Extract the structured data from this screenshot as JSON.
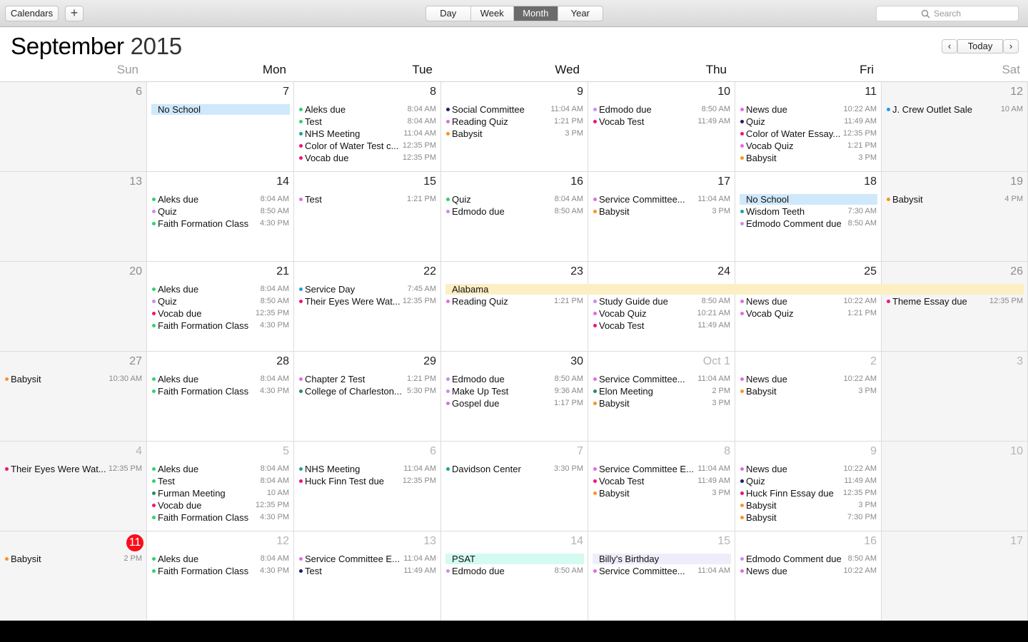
{
  "toolbar": {
    "calendars_label": "Calendars",
    "add_label": "+",
    "views": [
      "Day",
      "Week",
      "Month",
      "Year"
    ],
    "active_view": "Month",
    "search_placeholder": "Search"
  },
  "header": {
    "month": "September",
    "year": "2015",
    "today_label": "Today",
    "prev_label": "‹",
    "next_label": "›"
  },
  "weekdays": [
    "Sun",
    "Mon",
    "Tue",
    "Wed",
    "Thu",
    "Fri",
    "Sat"
  ],
  "colors": {
    "green": "#2bd46b",
    "purple": "#c98bf0",
    "teal": "#1ba39b",
    "pink": "#f0127a",
    "orange": "#f8951d",
    "blue": "#1e9af4",
    "navy": "#1c1c6e",
    "darkgreen": "#2b8a5a",
    "magenta": "#e66be0",
    "today_red": "#fb0d1b",
    "bar_blue": "#cfe8fb",
    "bar_yellow": "#fcefc4",
    "bar_mint": "#d4fbf1",
    "bar_lavender": "#eeeefb"
  },
  "weeks": [
    {
      "days": [
        {
          "num": "6",
          "dim": false,
          "events": []
        },
        {
          "num": "7",
          "dim": false,
          "events": []
        },
        {
          "num": "8",
          "dim": false,
          "events": [
            {
              "name": "Aleks due",
              "time": "8:04 AM",
              "color": "green"
            },
            {
              "name": "Test",
              "time": "8:04 AM",
              "color": "green"
            },
            {
              "name": "NHS Meeting",
              "time": "11:04 AM",
              "color": "teal"
            },
            {
              "name": "Color of Water Test c...",
              "time": "12:35 PM",
              "color": "pink"
            },
            {
              "name": "Vocab due",
              "time": "12:35 PM",
              "color": "pink"
            }
          ]
        },
        {
          "num": "9",
          "dim": false,
          "events": [
            {
              "name": "Social Committee",
              "time": "11:04 AM",
              "color": "navy"
            },
            {
              "name": "Reading Quiz",
              "time": "1:21 PM",
              "color": "magenta"
            },
            {
              "name": "Babysit",
              "time": "3 PM",
              "color": "orange"
            }
          ]
        },
        {
          "num": "10",
          "dim": false,
          "events": [
            {
              "name": "Edmodo due",
              "time": "8:50 AM",
              "color": "purple"
            },
            {
              "name": "Vocab Test",
              "time": "11:49 AM",
              "color": "pink"
            }
          ]
        },
        {
          "num": "11",
          "dim": false,
          "events": [
            {
              "name": "News due",
              "time": "10:22 AM",
              "color": "magenta"
            },
            {
              "name": "Quiz",
              "time": "11:49 AM",
              "color": "navy"
            },
            {
              "name": "Color of Water Essay...",
              "time": "12:35 PM",
              "color": "pink"
            },
            {
              "name": "Vocab Quiz",
              "time": "1:21 PM",
              "color": "magenta"
            },
            {
              "name": "Babysit",
              "time": "3 PM",
              "color": "orange"
            }
          ]
        },
        {
          "num": "12",
          "dim": false,
          "events": [
            {
              "name": "J. Crew Outlet Sale",
              "time": "10 AM",
              "color": "blue"
            }
          ]
        }
      ],
      "bars": [
        {
          "label": "No School",
          "start": 1,
          "span": 1,
          "color": "bar_blue",
          "row": 0
        }
      ]
    },
    {
      "days": [
        {
          "num": "13",
          "dim": false,
          "events": []
        },
        {
          "num": "14",
          "dim": false,
          "events": [
            {
              "name": "Aleks due",
              "time": "8:04 AM",
              "color": "green"
            },
            {
              "name": "Quiz",
              "time": "8:50 AM",
              "color": "purple"
            },
            {
              "name": "Faith Formation Class",
              "time": "4:30 PM",
              "color": "green"
            }
          ]
        },
        {
          "num": "15",
          "dim": false,
          "events": [
            {
              "name": "Test",
              "time": "1:21 PM",
              "color": "magenta"
            }
          ]
        },
        {
          "num": "16",
          "dim": false,
          "events": [
            {
              "name": "Quiz",
              "time": "8:04 AM",
              "color": "green"
            },
            {
              "name": "Edmodo due",
              "time": "8:50 AM",
              "color": "purple"
            }
          ]
        },
        {
          "num": "17",
          "dim": false,
          "events": [
            {
              "name": "Service Committee...",
              "time": "11:04 AM",
              "color": "magenta"
            },
            {
              "name": "Babysit",
              "time": "3 PM",
              "color": "orange"
            }
          ]
        },
        {
          "num": "18",
          "dim": false,
          "offset": 1,
          "events": [
            {
              "name": "Wisdom Teeth",
              "time": "7:30 AM",
              "color": "teal"
            },
            {
              "name": "Edmodo Comment due",
              "time": "8:50 AM",
              "color": "purple"
            }
          ]
        },
        {
          "num": "19",
          "dim": false,
          "events": [
            {
              "name": "Babysit",
              "time": "4 PM",
              "color": "orange"
            }
          ]
        }
      ],
      "bars": [
        {
          "label": "No School",
          "start": 5,
          "span": 1,
          "color": "bar_blue",
          "row": 0
        }
      ]
    },
    {
      "days": [
        {
          "num": "20",
          "dim": false,
          "events": []
        },
        {
          "num": "21",
          "dim": false,
          "events": [
            {
              "name": "Aleks due",
              "time": "8:04 AM",
              "color": "green"
            },
            {
              "name": "Quiz",
              "time": "8:50 AM",
              "color": "purple"
            },
            {
              "name": "Vocab due",
              "time": "12:35 PM",
              "color": "pink"
            },
            {
              "name": "Faith Formation Class",
              "time": "4:30 PM",
              "color": "green"
            }
          ]
        },
        {
          "num": "22",
          "dim": false,
          "events": [
            {
              "name": "Service Day",
              "time": "7:45 AM",
              "color": "blue"
            },
            {
              "name": "Their Eyes Were Wat...",
              "time": "12:35 PM",
              "color": "pink"
            }
          ]
        },
        {
          "num": "23",
          "dim": false,
          "offset": 1,
          "events": [
            {
              "name": "Reading Quiz",
              "time": "1:21 PM",
              "color": "magenta"
            }
          ]
        },
        {
          "num": "24",
          "dim": false,
          "offset": 1,
          "events": [
            {
              "name": "Study Guide due",
              "time": "8:50 AM",
              "color": "purple"
            },
            {
              "name": "Vocab Quiz",
              "time": "10:21 AM",
              "color": "magenta"
            },
            {
              "name": "Vocab Test",
              "time": "11:49 AM",
              "color": "pink"
            }
          ]
        },
        {
          "num": "25",
          "dim": false,
          "offset": 1,
          "events": [
            {
              "name": "News due",
              "time": "10:22 AM",
              "color": "magenta"
            },
            {
              "name": "Vocab Quiz",
              "time": "1:21 PM",
              "color": "magenta"
            }
          ]
        },
        {
          "num": "26",
          "dim": false,
          "offset": 1,
          "events": [
            {
              "name": "Theme Essay due",
              "time": "12:35 PM",
              "color": "pink"
            }
          ]
        }
      ],
      "bars": [
        {
          "label": "Alabama",
          "start": 3,
          "span": 4,
          "color": "bar_yellow",
          "row": 0
        }
      ]
    },
    {
      "days": [
        {
          "num": "27",
          "dim": false,
          "events": [
            {
              "name": "Babysit",
              "time": "10:30 AM",
              "color": "orange"
            }
          ]
        },
        {
          "num": "28",
          "dim": false,
          "events": [
            {
              "name": "Aleks due",
              "time": "8:04 AM",
              "color": "green"
            },
            {
              "name": "Faith Formation Class",
              "time": "4:30 PM",
              "color": "green"
            }
          ]
        },
        {
          "num": "29",
          "dim": false,
          "events": [
            {
              "name": "Chapter 2 Test",
              "time": "1:21 PM",
              "color": "magenta"
            },
            {
              "name": "College of Charleston...",
              "time": "5:30 PM",
              "color": "darkgreen"
            }
          ]
        },
        {
          "num": "30",
          "dim": false,
          "events": [
            {
              "name": "Edmodo due",
              "time": "8:50 AM",
              "color": "purple"
            },
            {
              "name": "Make Up Test",
              "time": "9:36 AM",
              "color": "purple"
            },
            {
              "name": "Gospel due",
              "time": "1:17 PM",
              "color": "magenta"
            }
          ]
        },
        {
          "num": "Oct 1",
          "dim": true,
          "events": [
            {
              "name": "Service Committee...",
              "time": "11:04 AM",
              "color": "magenta"
            },
            {
              "name": "Elon Meeting",
              "time": "2 PM",
              "color": "darkgreen"
            },
            {
              "name": "Babysit",
              "time": "3 PM",
              "color": "orange"
            }
          ]
        },
        {
          "num": "2",
          "dim": true,
          "events": [
            {
              "name": "News due",
              "time": "10:22 AM",
              "color": "magenta"
            },
            {
              "name": "Babysit",
              "time": "3 PM",
              "color": "orange"
            }
          ]
        },
        {
          "num": "3",
          "dim": true,
          "events": []
        }
      ],
      "bars": []
    },
    {
      "days": [
        {
          "num": "4",
          "dim": true,
          "events": [
            {
              "name": "Their Eyes Were Wat...",
              "time": "12:35 PM",
              "color": "pink"
            }
          ]
        },
        {
          "num": "5",
          "dim": true,
          "events": [
            {
              "name": "Aleks due",
              "time": "8:04 AM",
              "color": "green"
            },
            {
              "name": "Test",
              "time": "8:04 AM",
              "color": "green"
            },
            {
              "name": "Furman Meeting",
              "time": "10 AM",
              "color": "darkgreen"
            },
            {
              "name": "Vocab due",
              "time": "12:35 PM",
              "color": "pink"
            },
            {
              "name": "Faith Formation Class",
              "time": "4:30 PM",
              "color": "green"
            }
          ]
        },
        {
          "num": "6",
          "dim": true,
          "events": [
            {
              "name": "NHS Meeting",
              "time": "11:04 AM",
              "color": "teal"
            },
            {
              "name": "Huck Finn Test due",
              "time": "12:35 PM",
              "color": "pink"
            }
          ]
        },
        {
          "num": "7",
          "dim": true,
          "events": [
            {
              "name": "Davidson Center",
              "time": "3:30 PM",
              "color": "teal"
            }
          ]
        },
        {
          "num": "8",
          "dim": true,
          "events": [
            {
              "name": "Service Committee E...",
              "time": "11:04 AM",
              "color": "magenta"
            },
            {
              "name": "Vocab Test",
              "time": "11:49 AM",
              "color": "pink"
            },
            {
              "name": "Babysit",
              "time": "3 PM",
              "color": "orange"
            }
          ]
        },
        {
          "num": "9",
          "dim": true,
          "events": [
            {
              "name": "News due",
              "time": "10:22 AM",
              "color": "magenta"
            },
            {
              "name": "Quiz",
              "time": "11:49 AM",
              "color": "navy"
            },
            {
              "name": "Huck Finn Essay due",
              "time": "12:35 PM",
              "color": "pink"
            },
            {
              "name": "Babysit",
              "time": "3 PM",
              "color": "orange"
            },
            {
              "name": "Babysit",
              "time": "7:30 PM",
              "color": "orange"
            }
          ]
        },
        {
          "num": "10",
          "dim": true,
          "events": []
        }
      ],
      "bars": []
    },
    {
      "days": [
        {
          "num": "11",
          "dim": false,
          "today": true,
          "events": [
            {
              "name": "Babysit",
              "time": "2 PM",
              "color": "orange"
            }
          ]
        },
        {
          "num": "12",
          "dim": true,
          "events": [
            {
              "name": "Aleks due",
              "time": "8:04 AM",
              "color": "green"
            },
            {
              "name": "Faith Formation Class",
              "time": "4:30 PM",
              "color": "green"
            }
          ]
        },
        {
          "num": "13",
          "dim": true,
          "events": [
            {
              "name": "Service Committee E...",
              "time": "11:04 AM",
              "color": "magenta"
            },
            {
              "name": "Test",
              "time": "11:49 AM",
              "color": "navy"
            }
          ]
        },
        {
          "num": "14",
          "dim": true,
          "offset": 1,
          "events": [
            {
              "name": "Edmodo due",
              "time": "8:50 AM",
              "color": "purple"
            }
          ]
        },
        {
          "num": "15",
          "dim": true,
          "offset": 1,
          "events": [
            {
              "name": "Service Committee...",
              "time": "11:04 AM",
              "color": "magenta"
            }
          ]
        },
        {
          "num": "16",
          "dim": true,
          "events": [
            {
              "name": "Edmodo Comment due",
              "time": "8:50 AM",
              "color": "purple"
            },
            {
              "name": "News due",
              "time": "10:22 AM",
              "color": "magenta"
            }
          ]
        },
        {
          "num": "17",
          "dim": true,
          "events": []
        }
      ],
      "bars": [
        {
          "label": "PSAT",
          "start": 3,
          "span": 1,
          "color": "bar_mint",
          "row": 0
        },
        {
          "label": "Billy's Birthday",
          "start": 4,
          "span": 1,
          "color": "bar_lavender",
          "row": 0
        }
      ]
    }
  ]
}
